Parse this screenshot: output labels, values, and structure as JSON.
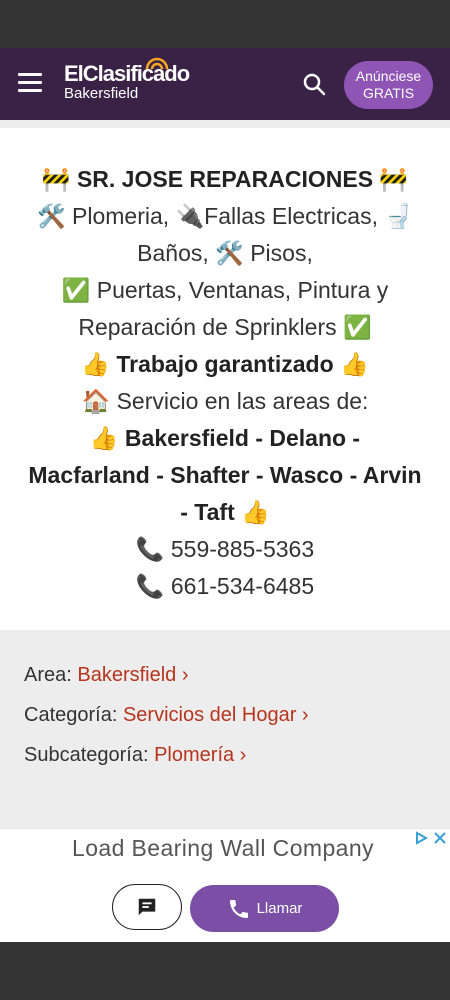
{
  "header": {
    "brand": "ElClasificado",
    "city": "Bakersfield",
    "promo_line1": "Anúnciese",
    "promo_line2": "GRATIS"
  },
  "listing": {
    "lines": [
      "🚧 SR. JOSE REPARACIONES 🚧",
      "🛠️ Plomeria, 🔌Fallas Electricas, 🚽",
      "Baños, 🛠️ Pisos,",
      "✅ Puertas, Ventanas, Pintura y",
      "Reparación de Sprinklers ✅",
      "👍 Trabajo garantizado 👍",
      "🏠 Servicio en las areas de:",
      "👍 Bakersfield - Delano -",
      "Macfarland - Shafter - Wasco - Arvin",
      "- Taft 👍",
      "📞 559-885-5363",
      "📞 661-534-6485"
    ]
  },
  "details": {
    "area_label": "Area: ",
    "area_value": "Bakersfield ›",
    "category_label": "Categoría: ",
    "category_value": "Servicios del Hogar ›",
    "subcategory_label": "Subcategoría: ",
    "subcategory_value": "Plomería ›"
  },
  "ad": {
    "text": "Load Bearing Wall Company"
  },
  "actions": {
    "call_label": "Llamar"
  },
  "colors": {
    "navbar": "#3a2246",
    "accent": "#7b4fa6",
    "link": "#b5351e"
  },
  "icons": [
    "menu-icon",
    "search-icon",
    "chat-icon",
    "phone-icon",
    "adchoices-icon",
    "close-icon"
  ]
}
